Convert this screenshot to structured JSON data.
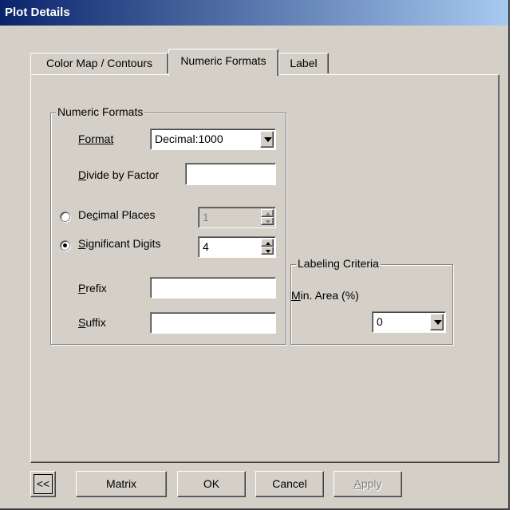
{
  "window": {
    "title": "Plot Details"
  },
  "tabs": [
    {
      "label": "Color Map / Contours",
      "active": false
    },
    {
      "label": "Numeric Formats",
      "active": true
    },
    {
      "label": "Label",
      "active": false
    }
  ],
  "numeric_formats": {
    "group_title": "Numeric Formats",
    "format_label": "Format",
    "format_value": "Decimal:1000",
    "divide_label": "Divide by Factor",
    "divide_value": "",
    "decimal_places_label": "Decimal Places",
    "decimal_places_value": "1",
    "decimal_places_selected": false,
    "significant_digits_label": "Significant Digits",
    "significant_digits_value": "4",
    "significant_digits_selected": true,
    "prefix_label": "Prefix",
    "prefix_value": "",
    "suffix_label": "Suffix",
    "suffix_value": ""
  },
  "labeling_criteria": {
    "group_title": "Labeling Criteria",
    "min_area_label": "Min. Area (%)",
    "min_area_value": "0"
  },
  "buttons": {
    "collapse": "<<",
    "matrix": "Matrix",
    "ok": "OK",
    "cancel": "Cancel",
    "apply": "Apply"
  }
}
